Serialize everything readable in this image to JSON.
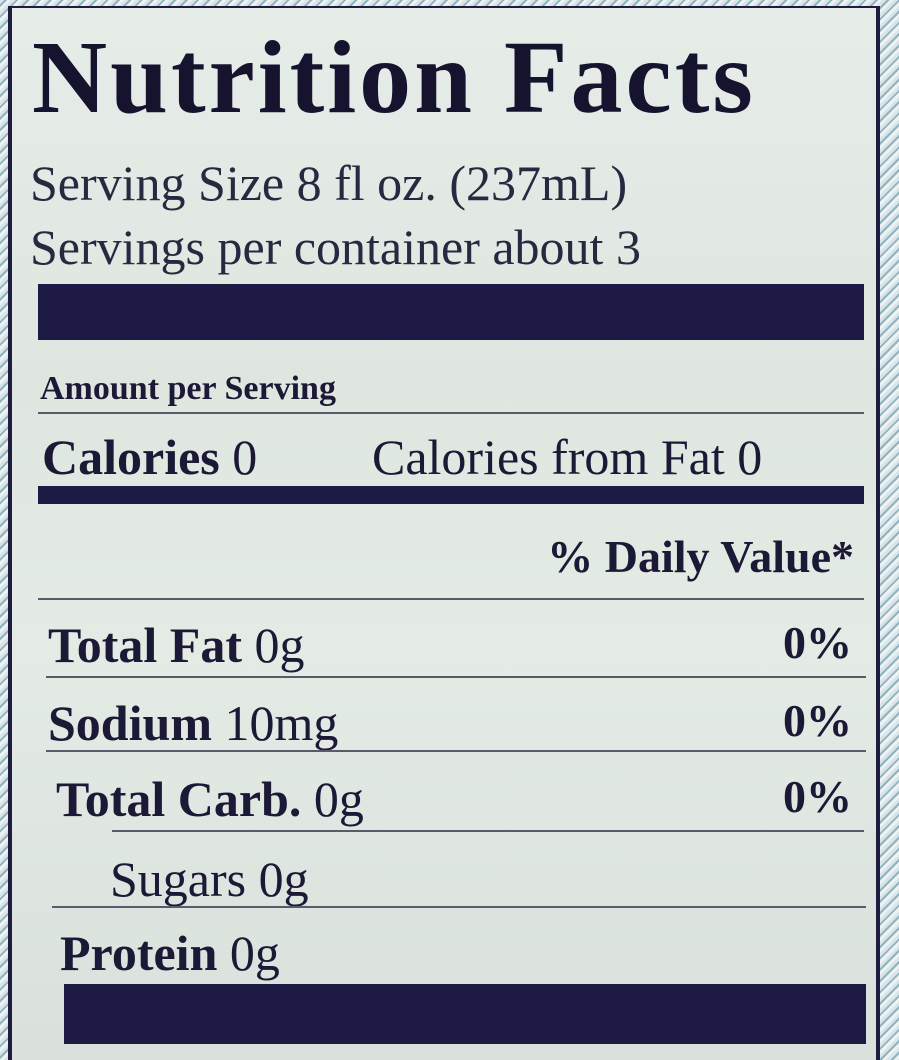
{
  "title": "Nutrition Facts",
  "serving_size": "Serving Size 8 fl oz. (237mL)",
  "servings_per_container": "Servings per container about 3",
  "amount_per_serving": "Amount per Serving",
  "calories": {
    "label": "Calories",
    "value": "0",
    "from_fat": "Calories from Fat 0"
  },
  "daily_value_header": "% Daily Value*",
  "nutrients": [
    {
      "label": "Total Fat",
      "amount": "0g",
      "dv": "0%"
    },
    {
      "label": "Sodium",
      "amount": "10mg",
      "dv": "0%"
    },
    {
      "label": "Total Carb.",
      "amount": "0g",
      "dv": "0%"
    },
    {
      "label": "Sugars",
      "amount": "0g",
      "dv": ""
    },
    {
      "label": "Protein",
      "amount": "0g",
      "dv": ""
    }
  ],
  "colors": {
    "ink": "#1d1a44",
    "label_bg": "#e2e9e3"
  }
}
